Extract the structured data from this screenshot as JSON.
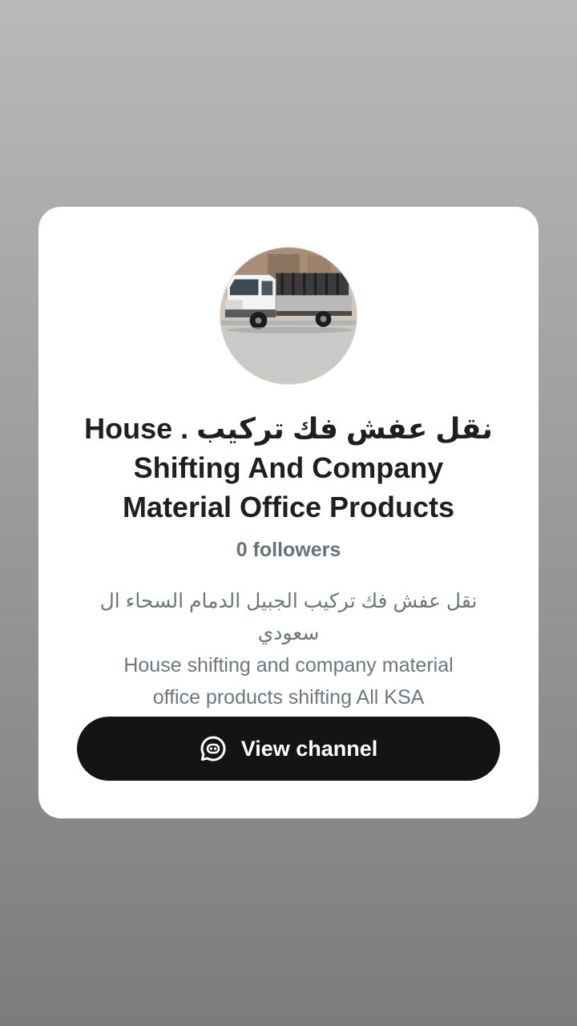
{
  "channel": {
    "title_lines": [
      "نقل عفش فك تركيب . House",
      "Shifting And Company",
      "Material Office Products"
    ],
    "followers": "0 followers",
    "description_lines": [
      "نقل عفش فك تركيب الجبيل الدمام السحاء ال سعودي",
      "House shifting and company material",
      "office products shifting All KSA"
    ],
    "avatar_icon": "truck-photo"
  },
  "actions": {
    "view_channel_label": "View channel",
    "view_channel_icon": "channel-icon"
  },
  "colors": {
    "button_bg": "#141414",
    "card_bg": "#ffffff",
    "title_text": "#1f1f1f",
    "secondary_text": "#6a7177"
  }
}
